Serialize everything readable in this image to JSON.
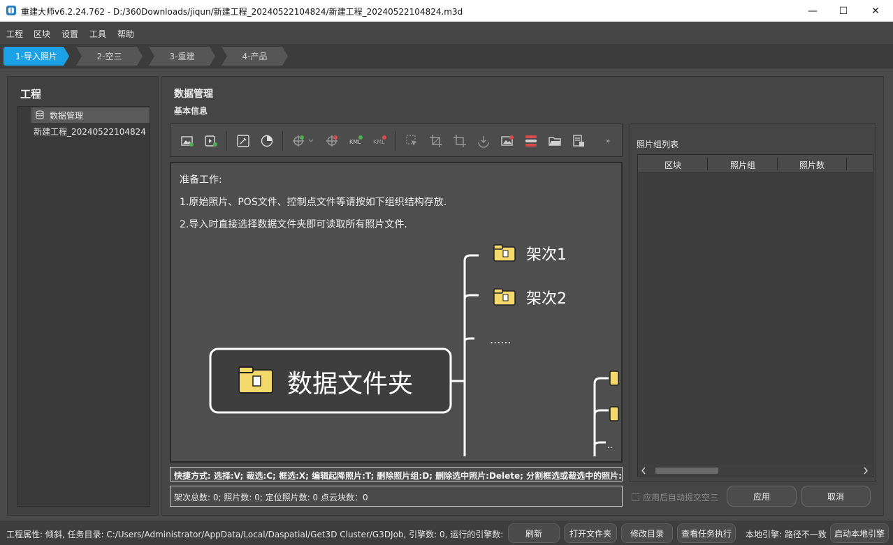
{
  "window": {
    "title": "重建大师v6.2.24.762 - D:/360Downloads/jiqun/新建工程_20240522104824/新建工程_20240522104824.m3d",
    "minimize": "—",
    "maximize": "☐",
    "close": "✕"
  },
  "menu": [
    "工程",
    "区块",
    "设置",
    "工具",
    "帮助"
  ],
  "steps": [
    "1-导入照片",
    "2-空三",
    "3-重建",
    "4-产品"
  ],
  "project_panel": {
    "title": "工程",
    "items": [
      "数据管理",
      "新建工程_20240522104824"
    ]
  },
  "main": {
    "title": "数据管理",
    "subtitle": "基本信息",
    "toolbar_more": "»",
    "instructions": [
      "准备工作:",
      "1.原始照片、POS文件、控制点文件等请按如下组织结构存放.",
      "2.导入时直接选择数据文件夹即可读取所有照片文件."
    ],
    "diagram": {
      "root": "数据文件夹",
      "branches": [
        "架次1",
        "架次2",
        "......"
      ],
      "sub_ellipsis": ".."
    },
    "shortcut": "快捷方式: 选择:V; 裁选:C; 框选:X; 编辑起降照片:T; 删除照片组:D; 删除选中照片:Delete; 分割框选或裁选中的照片:F",
    "stats": "架次总数: 0; 照片数: 0; 定位照片数: 0 点云块数：0"
  },
  "photo_groups": {
    "title": "照片组列表",
    "columns": [
      "区块",
      "照片组",
      "照片数"
    ],
    "rows": []
  },
  "auto_submit": {
    "label": "应用后自动提交空三",
    "checked": false
  },
  "buttons": {
    "apply": "应用",
    "cancel": "取消"
  },
  "statusbar": {
    "properties": "工程属性: 倾斜, 任务目录: C:/Users/Administrator/AppData/Local/Daspatial/Get3D Cluster/G3DJob, 引擎数: 0, 运行的引擎数: 0.",
    "refresh": "刷新",
    "open_folder": "打开文件夹",
    "modify_dir": "修改目录",
    "view_tasks": "查看任务执行",
    "local_engine": "本地引擎: 路径不一致",
    "start_engine": "启动本地引擎"
  },
  "colors": {
    "accent": "#1aa1e6",
    "folder": "#f3d96b"
  }
}
